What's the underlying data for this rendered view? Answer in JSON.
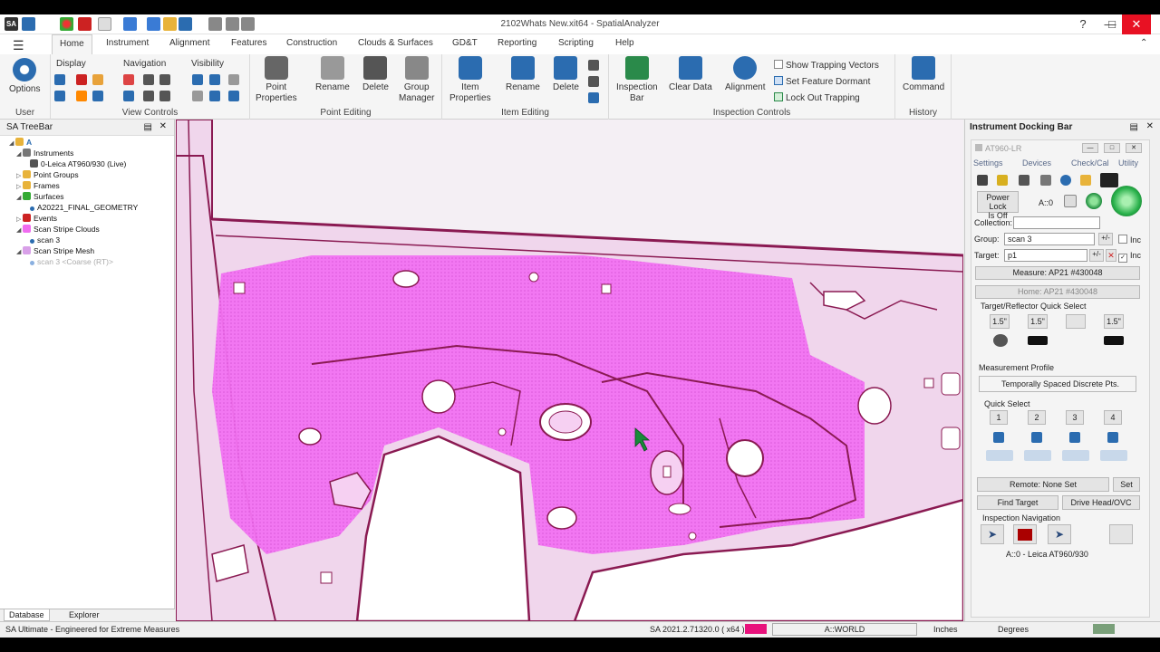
{
  "window": {
    "title": "2102Whats New.xit64 - SpatialAnalyzer"
  },
  "tabs": [
    "Home",
    "Instrument",
    "Alignment",
    "Features",
    "Construction",
    "Clouds & Surfaces",
    "GD&T",
    "Reporting",
    "Scripting",
    "Help"
  ],
  "ribbon": {
    "user": {
      "options": "Options",
      "label": "User"
    },
    "view": {
      "display": "Display",
      "navigation": "Navigation",
      "visibility": "Visibility",
      "label": "View Controls"
    },
    "point": {
      "props": "Point",
      "props2": "Properties",
      "rename": "Rename",
      "delete": "Delete",
      "group": "Group",
      "group2": "Manager",
      "label": "Point Editing"
    },
    "item": {
      "props": "Item",
      "props2": "Properties",
      "rename": "Rename",
      "delete": "Delete",
      "label": "Item Editing"
    },
    "inspection": {
      "bar": "Inspection",
      "bar2": "Bar",
      "clear": "Clear Data",
      "alignment": "Alignment",
      "show_trap": "Show Trapping Vectors",
      "dormant": "Set Feature Dormant",
      "lockout": "Lock Out Trapping",
      "label": "Inspection Controls"
    },
    "history": {
      "command": "Command",
      "label": "History"
    }
  },
  "tree": {
    "title": "SA TreeBar",
    "root": "A",
    "instruments": "Instruments",
    "instrument_item": "0-Leica AT960/930 (Live)",
    "point_groups": "Point Groups",
    "frames": "Frames",
    "surfaces": "Surfaces",
    "surface_item": "A20221_FINAL_GEOMETRY",
    "events": "Events",
    "clouds": "Scan Stripe Clouds",
    "cloud_item": "scan 3",
    "mesh": "Scan Stripe Mesh",
    "mesh_item": "scan 3 <Coarse (RT)>",
    "tab_database": "Database",
    "tab_explorer": "Explorer"
  },
  "instrument_bar": {
    "title": "Instrument Docking Bar",
    "instrument": "AT960-LR",
    "menu": [
      "Settings",
      "Devices",
      "Check/Cal",
      "Utility"
    ],
    "power_lock": "Power Lock",
    "power_lock2": "Is Off",
    "station": "A::0",
    "collection_label": "Collection:",
    "collection_value": "",
    "group_label": "Group:",
    "group_value": "scan 3",
    "target_label": "Target:",
    "target_value": "p1",
    "pm": "+/-",
    "inc": "Inc",
    "measure": "Measure: AP21 #430048",
    "home": "Home: AP21 #430048",
    "quick_select_target": "Target/Reflector Quick Select",
    "target_sizes": [
      "1.5\"",
      "1.5\"",
      "",
      "1.5\""
    ],
    "measurement_profile": "Measurement Profile",
    "profile_value": "Temporally Spaced Discrete Pts.",
    "quick_select": "Quick Select",
    "quick_buttons": [
      "1",
      "2",
      "3",
      "4"
    ],
    "remote": "Remote: None Set",
    "set": "Set",
    "find_target": "Find Target",
    "drive_head": "Drive Head/OVC",
    "inspection_nav": "Inspection Navigation",
    "instrument_name": "A::0 - Leica AT960/930"
  },
  "status": {
    "left": "SA Ultimate - Engineered for Extreme Measures",
    "version": "SA 2021.2.71320.0 ( x64 )",
    "frame": "A::WORLD",
    "units_length": "Inches",
    "units_angle": "Degrees"
  },
  "colors": {
    "accent": "#2b6cb0",
    "cloud": "#f06cf0",
    "mesh_edge": "#8a1a52",
    "status_swatch": "#e8127c"
  }
}
